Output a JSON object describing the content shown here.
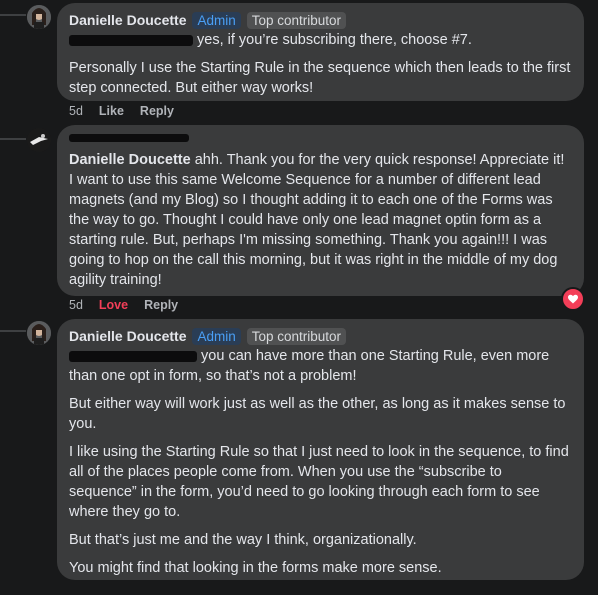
{
  "comments": [
    {
      "author": "Danielle Doucette",
      "badge_admin": "Admin",
      "badge_top": "Top contributor",
      "para1": "yes, if you’re subscribing there, choose #7.",
      "para2": "Personally I use the Starting Rule in the sequence which then leads to the first step connected. But either way works!",
      "time": "5d",
      "like": "Like",
      "reply": "Reply"
    },
    {
      "tagged": "Danielle Doucette",
      "text": "ahh. Thank you for the very quick response! Appreciate it! I want to use this same Welcome Sequence for a number of different lead magnets (and my Blog) so I thought adding it to each one of the Forms was the way to go. Thought I could have only one lead magnet optin form as a starting rule. But, perhaps I'm missing something. Thank you again!!! I was going to hop on the call this morning, but it was right in the middle of my dog agility training!",
      "time": "5d",
      "love": "Love",
      "reply": "Reply",
      "reaction_icon": "heart-icon"
    },
    {
      "author": "Danielle Doucette",
      "badge_admin": "Admin",
      "badge_top": "Top contributor",
      "para1": "you can have more than one Starting Rule, even more than one opt in form, so that’s not a problem!",
      "para2": "But either way will work just as well as the other, as long as it makes sense to you.",
      "para3": "I like using the Starting Rule so that I just need to look in the sequence, to find all of the places people come from. When you use the “subscribe to sequence” in the form, you’d need to go looking through each form to see where they go to.",
      "para4": "But that’s just me and the way I think, organizationally.",
      "para5": "You might find that looking in the forms make more sense."
    }
  ],
  "colors": {
    "background": "#18191a",
    "bubble": "#3a3b3c",
    "admin_badge": "#4a9ff5",
    "love": "#f33e58"
  }
}
